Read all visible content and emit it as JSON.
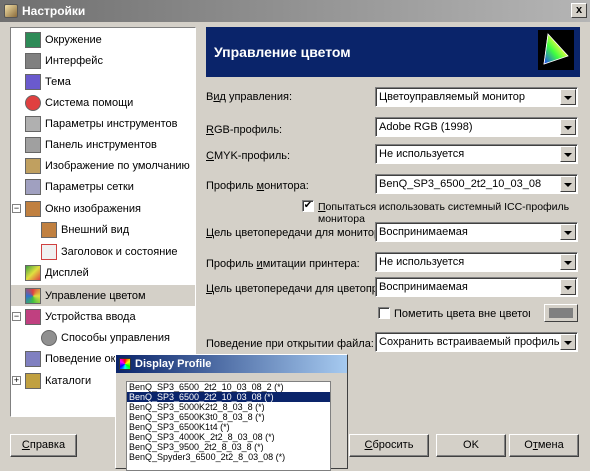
{
  "window": {
    "title": "Настройки",
    "close_glyph": "x"
  },
  "sidebar": {
    "items": [
      {
        "label": "Окружение",
        "icon": "environment-icon",
        "color": "#2e8b57"
      },
      {
        "label": "Интерфейс",
        "icon": "interface-icon",
        "color": "#808080"
      },
      {
        "label": "Тема",
        "icon": "theme-icon",
        "color": "#6a5acd"
      },
      {
        "label": "Система помощи",
        "icon": "help-icon",
        "color": "#e04040"
      },
      {
        "label": "Параметры инструментов",
        "icon": "tool-options-icon",
        "color": "#b0b0b0"
      },
      {
        "label": "Панель инструментов",
        "icon": "toolbox-icon",
        "color": "#a0a0a0"
      },
      {
        "label": "Изображение по умолчанию",
        "icon": "default-image-icon",
        "color": "#c0a060"
      },
      {
        "label": "Параметры сетки",
        "icon": "grid-icon",
        "color": "#a0a0c0"
      },
      {
        "label": "Окно изображения",
        "icon": "image-window-icon",
        "color": "#c08040"
      },
      {
        "label": "Внешний вид",
        "icon": "appearance-icon",
        "color": "#c08040"
      },
      {
        "label": "Заголовок и состояние",
        "icon": "title-status-icon",
        "color": "#d04040"
      },
      {
        "label": "Дисплей",
        "icon": "display-icon",
        "color": "#40a040"
      },
      {
        "label": "Управление цветом",
        "icon": "color-management-icon",
        "color": "#3070d0"
      },
      {
        "label": "Устройства ввода",
        "icon": "input-devices-icon",
        "color": "#c04080"
      },
      {
        "label": "Способы управления",
        "icon": "input-controllers-icon",
        "color": "#808080"
      },
      {
        "label": "Поведение окон",
        "icon": "window-management-icon",
        "color": "#8080c0"
      },
      {
        "label": "Каталоги",
        "icon": "folders-icon",
        "color": "#c0a040"
      }
    ]
  },
  "panel": {
    "title": "Управление цветом",
    "mode_label_pre": "В",
    "mode_label_u": "и",
    "mode_label_post": "д управления:",
    "mode_value": "Цветоуправляемый монитор",
    "rgb_label_pre": "",
    "rgb_label_u": "R",
    "rgb_label_post": "GB-профиль:",
    "rgb_value": "Adobe RGB (1998)",
    "cmyk_label_pre": "",
    "cmyk_label_u": "C",
    "cmyk_label_post": "MYK-профиль:",
    "cmyk_value": "Не используется",
    "monitor_label_pre": "Профиль ",
    "monitor_label_u": "м",
    "monitor_label_post": "онитора:",
    "monitor_value": "BenQ_SP3_6500_2t2_10_03_08",
    "system_profile_label_pre": "",
    "system_profile_label_u": "П",
    "system_profile_label_post": "опытаться использовать системный ICC-профиль монитора",
    "system_profile_checked": true,
    "display_intent_label_pre": "",
    "display_intent_label_u": "Ц",
    "display_intent_label_post": "ель цветопередачи для монитора:",
    "display_intent_value": "Воспринимаемая",
    "printer_label_pre": "Профиль ",
    "printer_label_u": "и",
    "printer_label_post": "митации принтера:",
    "printer_value": "Не используется",
    "proof_intent_label_pre": "",
    "proof_intent_label_u": "Ц",
    "proof_intent_label_post": "ель цветопередачи для цветопробы:",
    "proof_intent_value": "Воспринимаемая",
    "gamut_label": "Пометить цвета вне цветового охвата",
    "gamut_checked": false,
    "gamut_color": "#808080",
    "file_open_label_pre": "Поведение при открытии файла:",
    "file_open_label_u": "",
    "file_open_label_post": "",
    "file_open_value": "Сохранить встраиваемый профиль"
  },
  "buttons": {
    "help_pre": "",
    "help_u": "С",
    "help_post": "правка",
    "reset_pre": "",
    "reset_u": "С",
    "reset_post": "бросить",
    "ok": "OK",
    "cancel_pre": "О",
    "cancel_u": "т",
    "cancel_post": "мена"
  },
  "popup": {
    "title": "Display Profile",
    "items": [
      "BenQ_SP3_6500_2t2_10_03_08_2 (*)",
      "BenQ_SP3_6500_2t2_10_03_08 (*)",
      "BenQ_SP3_5000K2t2_8_03_8 (*)",
      "BenQ_SP3_6500K3t0_8_03_8 (*)",
      "BenQ_SP3_6500K1t4 (*)",
      "BenQ_SP3_4000K_2t2_8_03_08 (*)",
      "BenQ_SP3_9500_2t2_8_03_8 (*)",
      "BenQ_Spyder3_6500_2t2_8_03_08 (*)"
    ],
    "selected_index": 1
  }
}
